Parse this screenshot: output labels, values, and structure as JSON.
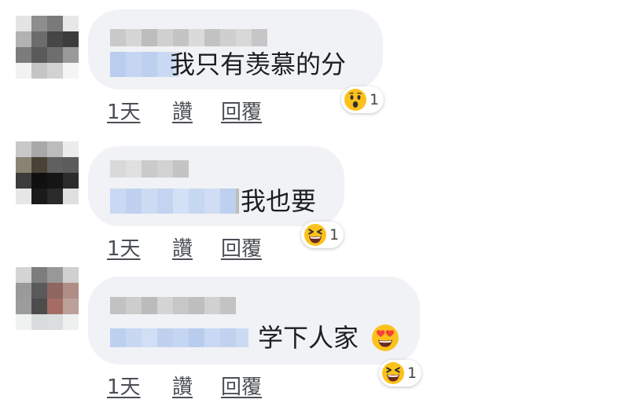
{
  "colors": {
    "bubble": "#f0f2f5",
    "text": "#1c1e21",
    "action_text": "#4b4f56",
    "mention_blue": "#bcd0ef",
    "name_gray": "#cccccc",
    "emoji_yellow": "#fcc21b"
  },
  "comments": [
    {
      "text": "我只有羡慕的分",
      "reaction": {
        "icon": "wow-emoji-icon",
        "count": "1"
      },
      "time": "1天",
      "like": "讚",
      "reply": "回覆"
    },
    {
      "text": "我也要",
      "reaction": {
        "icon": "laughing-emoji-icon",
        "count": "1"
      },
      "time": "1天",
      "like": "讚",
      "reply": "回覆"
    },
    {
      "text": "学下人家",
      "inline_emoji": "heart-eyes-emoji-icon",
      "reaction": {
        "icon": "laughing-emoji-icon",
        "count": "1"
      },
      "time": "1天",
      "like": "讚",
      "reply": "回覆"
    }
  ]
}
